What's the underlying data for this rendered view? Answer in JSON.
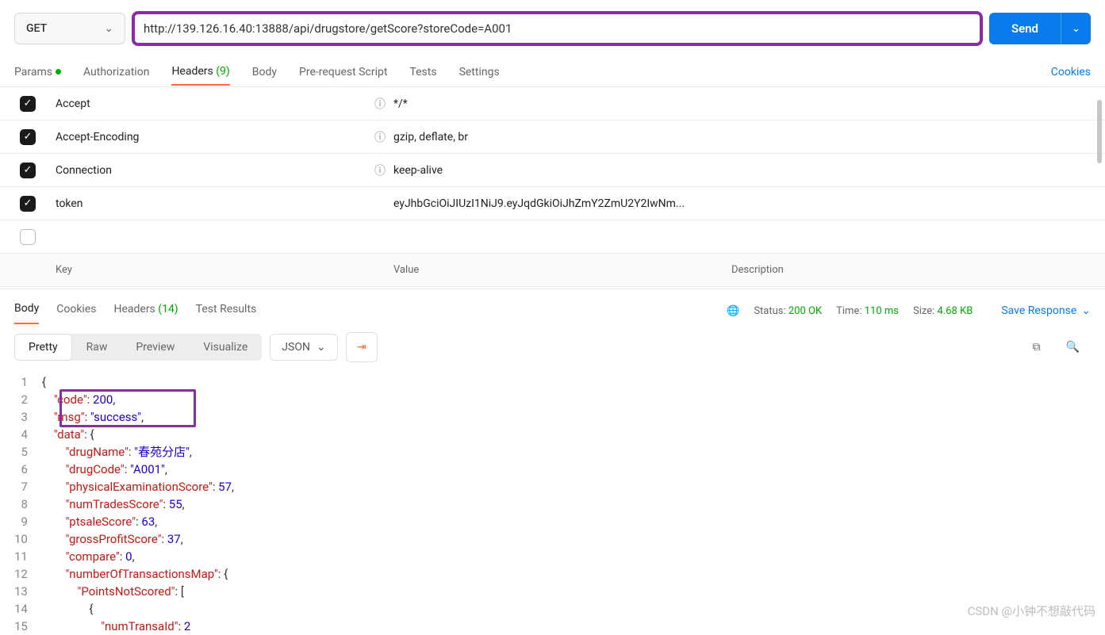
{
  "request": {
    "method": "GET",
    "url": "http://139.126.16.40:13888/api/drugstore/getScore?storeCode=A001",
    "sendLabel": "Send"
  },
  "reqTabs": {
    "params": "Params",
    "authorization": "Authorization",
    "headers": "Headers",
    "headersCount": "(9)",
    "body": "Body",
    "prerequest": "Pre-request Script",
    "tests": "Tests",
    "settings": "Settings",
    "cookies": "Cookies"
  },
  "headersTable": {
    "keyLabel": "Key",
    "valueLabel": "Value",
    "descLabel": "Description",
    "rows": [
      {
        "key": "Accept",
        "value": "*/*",
        "info": true
      },
      {
        "key": "Accept-Encoding",
        "value": "gzip, deflate, br",
        "info": true
      },
      {
        "key": "Connection",
        "value": "keep-alive",
        "info": true
      },
      {
        "key": "token",
        "value": "eyJhbGciOiJIUzI1NiJ9.eyJqdGkiOiJhZmY2ZmU2Y2IwNm...",
        "info": false
      }
    ]
  },
  "respTabs": {
    "body": "Body",
    "cookies": "Cookies",
    "headers": "Headers",
    "headersCount": "(14)",
    "testResults": "Test Results",
    "statusLabel": "Status:",
    "statusValue": "200 OK",
    "timeLabel": "Time:",
    "timeValue": "110 ms",
    "sizeLabel": "Size:",
    "sizeValue": "4.68 KB",
    "saveResponse": "Save Response"
  },
  "viewBar": {
    "pretty": "Pretty",
    "raw": "Raw",
    "preview": "Preview",
    "visualize": "Visualize",
    "format": "JSON"
  },
  "codeLines": {
    "l1": "{",
    "l2a": "\"code\"",
    "l2b": ": ",
    "l2c": "200",
    "l2d": ",",
    "l3a": "\"msg\"",
    "l3b": ": ",
    "l3c": "\"success\"",
    "l3d": ",",
    "l4a": "\"data\"",
    "l4b": ": {",
    "l5a": "\"drugName\"",
    "l5b": ": ",
    "l5c": "\"春苑分店\"",
    "l5d": ",",
    "l6a": "\"drugCode\"",
    "l6b": ": ",
    "l6c": "\"A001\"",
    "l6d": ",",
    "l7a": "\"physicalExaminationScore\"",
    "l7b": ": ",
    "l7c": "57",
    "l7d": ",",
    "l8a": "\"numTradesScore\"",
    "l8b": ": ",
    "l8c": "55",
    "l8d": ",",
    "l9a": "\"ptsaleScore\"",
    "l9b": ": ",
    "l9c": "63",
    "l9d": ",",
    "l10a": "\"grossProfitScore\"",
    "l10b": ": ",
    "l10c": "37",
    "l10d": ",",
    "l11a": "\"compare\"",
    "l11b": ": ",
    "l11c": "0",
    "l11d": ",",
    "l12a": "\"numberOfTransactionsMap\"",
    "l12b": ": {",
    "l13a": "\"PointsNotScored\"",
    "l13b": ": [",
    "l14": "{",
    "l15a": "\"numTransaId\"",
    "l15b": ": ",
    "l15c": "2"
  },
  "watermark": "CSDN @小钟不想敲代码"
}
